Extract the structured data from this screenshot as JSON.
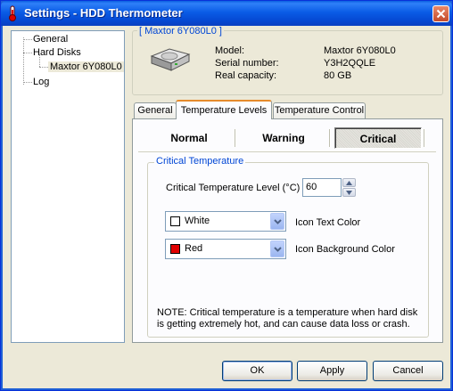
{
  "window": {
    "title": "Settings - HDD Thermometer",
    "title_icon": "thermometer-icon",
    "close_icon": "close-icon"
  },
  "tree": {
    "items": [
      {
        "label": "General"
      },
      {
        "label": "Hard Disks"
      },
      {
        "label": "Maxtor 6Y080L0"
      },
      {
        "label": "Log"
      }
    ]
  },
  "disk": {
    "legend": "[ Maxtor 6Y080L0 ]",
    "icon": "hard-disk-icon",
    "rows": [
      {
        "label": "Model:",
        "value": "Maxtor 6Y080L0"
      },
      {
        "label": "Serial number:",
        "value": "Y3H2QQLE"
      },
      {
        "label": "Real capacity:",
        "value": "80 GB"
      }
    ]
  },
  "tabs": [
    {
      "label": "General"
    },
    {
      "label": "Temperature Levels"
    },
    {
      "label": "Temperature Control"
    }
  ],
  "levels": {
    "normal": "Normal",
    "warning": "Warning",
    "critical": "Critical",
    "selected": "Critical"
  },
  "critical": {
    "legend": "Critical Temperature",
    "level_label": "Critical Temperature Level (°C)",
    "level_value": "60",
    "text_color": {
      "value": "White",
      "swatch": "#ffffff",
      "label": "Icon Text Color"
    },
    "bg_color": {
      "value": "Red",
      "swatch": "#e00000",
      "label": "Icon Background Color"
    },
    "note": "NOTE: Critical temperature is a temperature when hard disk is getting extremely hot, and can cause data loss or crash."
  },
  "buttons": {
    "ok": "OK",
    "apply": "Apply",
    "cancel": "Cancel"
  },
  "colors": {
    "titlebar": "#0a5ce6",
    "legend": "#0046d5",
    "active_tab": "#e68b2c"
  }
}
